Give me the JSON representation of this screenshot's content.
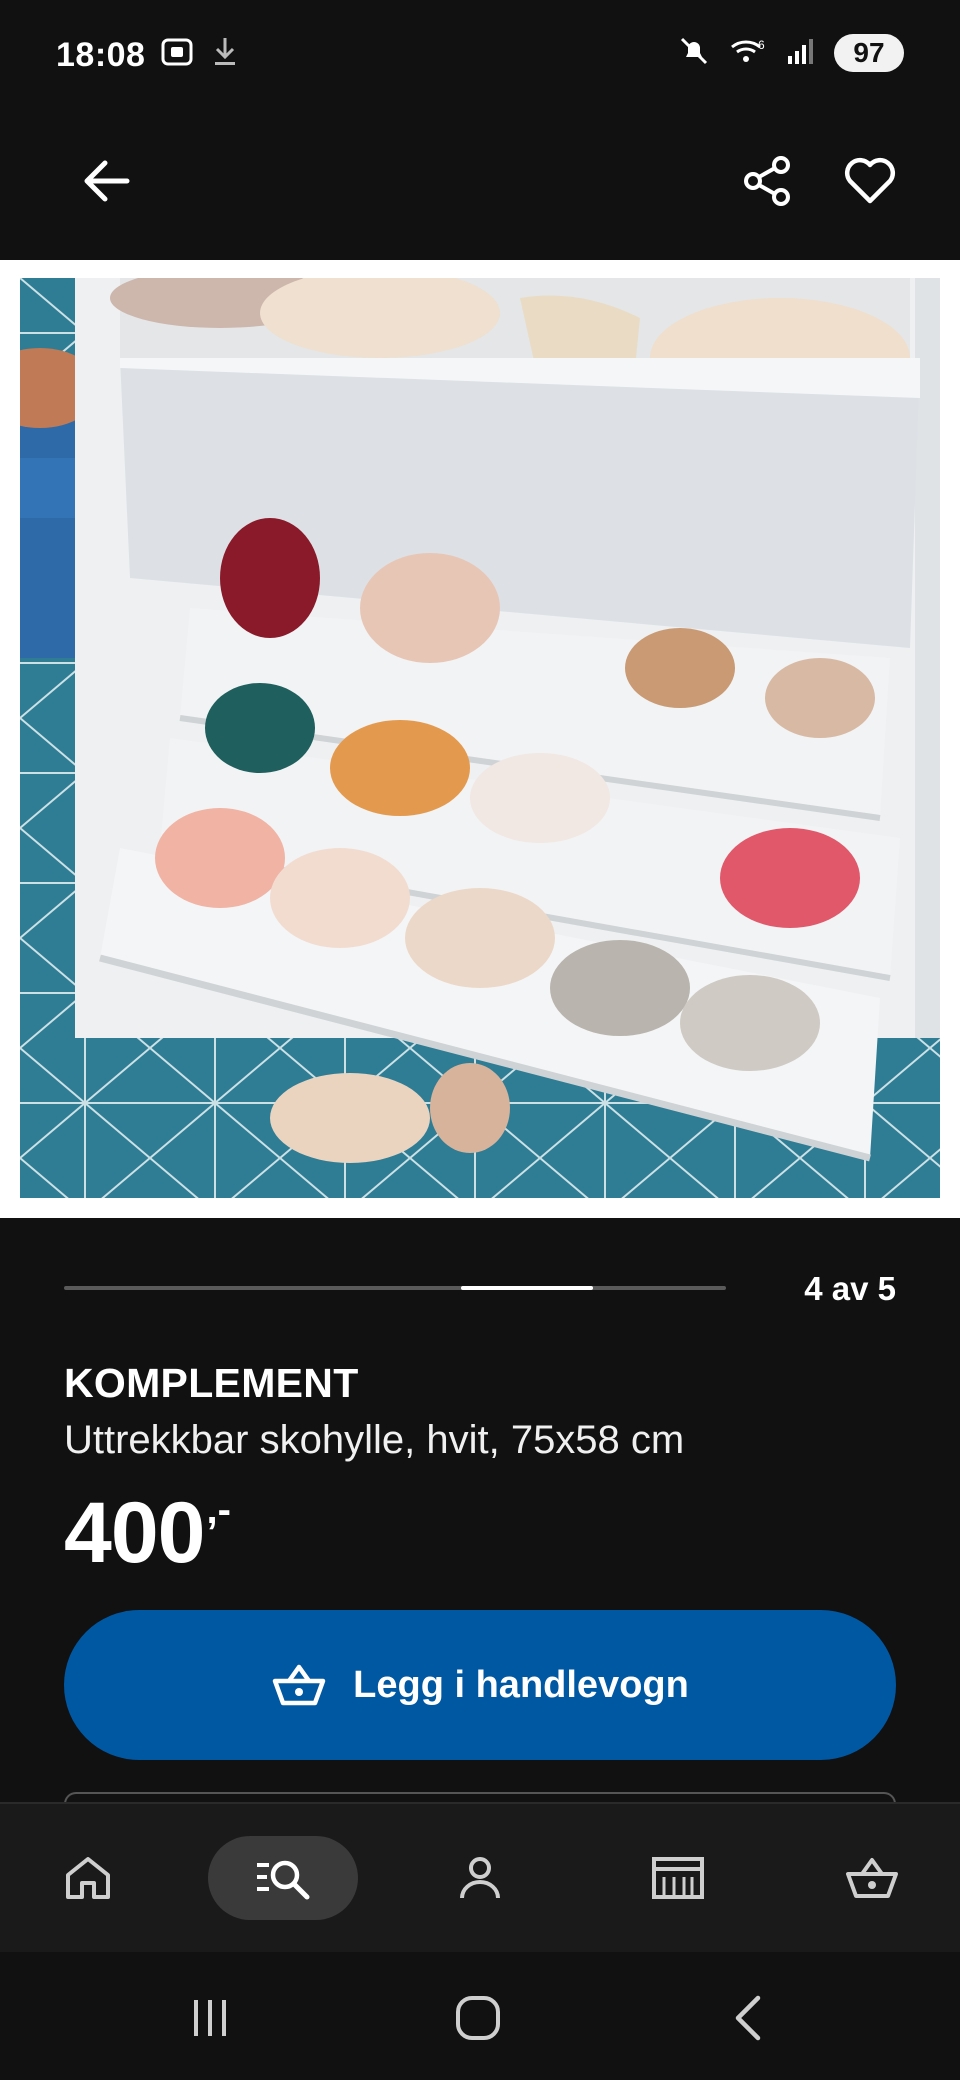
{
  "status_bar": {
    "time": "18:08",
    "battery": "97",
    "icons": [
      "screenshot-icon",
      "download-icon",
      "mute-icon",
      "wifi-icon",
      "signal-icon"
    ]
  },
  "app_bar": {
    "back_icon": "arrow-left-icon",
    "share_icon": "share-icon",
    "favorite_icon": "heart-icon"
  },
  "gallery": {
    "counter": "4 av 5",
    "current": 4,
    "total": 5
  },
  "product": {
    "brand": "KOMPLEMENT",
    "description": "Uttrekkbar skohylle, hvit, 75x58 cm",
    "price": "400",
    "price_suffix": ",-"
  },
  "cta": {
    "label": "Legg i handlevogn",
    "icon": "basket-icon",
    "color": "#0058a3"
  },
  "bottom_nav": {
    "items": [
      {
        "name": "home",
        "icon": "home-icon",
        "active": false
      },
      {
        "name": "search",
        "icon": "search-list-icon",
        "active": true
      },
      {
        "name": "profile",
        "icon": "person-icon",
        "active": false
      },
      {
        "name": "stores",
        "icon": "store-icon",
        "active": false
      },
      {
        "name": "cart",
        "icon": "basket-icon",
        "active": false
      }
    ]
  },
  "system_nav": {
    "icons": [
      "recents-icon",
      "home-circle-icon",
      "back-chevron-icon"
    ]
  }
}
